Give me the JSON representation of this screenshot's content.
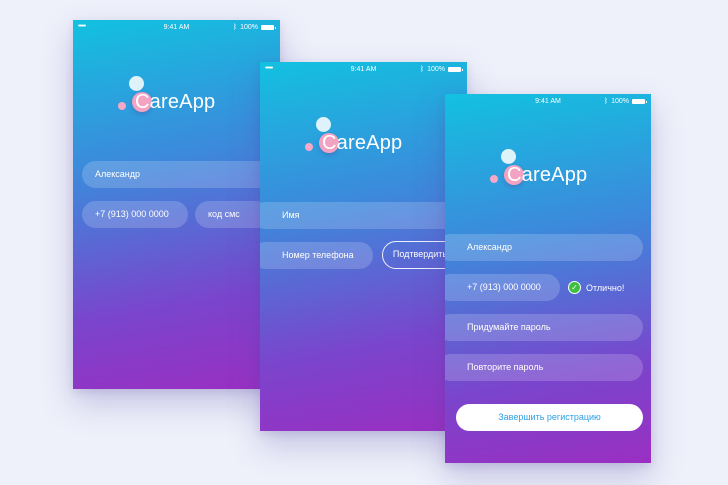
{
  "status_bar": {
    "time": "9:41 AM",
    "battery": "100%",
    "signal": "•••••",
    "wifi_icon": "wifi-icon",
    "bluetooth_icon": "bluetooth-icon"
  },
  "brand": {
    "c_letter": "C",
    "rest": "areApp"
  },
  "screen1": {
    "name_value": "Александр",
    "phone_value": "+7 (913) 000 0000",
    "sms_placeholder": "код смс"
  },
  "screen2": {
    "name_placeholder": "Имя",
    "phone_placeholder": "Номер телефона",
    "confirm_label": "Подтвердить"
  },
  "screen3": {
    "name_value": "Александр",
    "phone_value": "+7 (913) 000 0000",
    "ok_label": "Отлично!",
    "password_placeholder": "Придумайте пароль",
    "repeat_password_placeholder": "Повторите пароль",
    "finish_label": "Завершить регистрацию"
  },
  "colors": {
    "gradient_top": "#12c1e0",
    "gradient_bottom": "#9a2fc2",
    "accent_pink": "#f3a3c2",
    "success_green": "#3fbf3f",
    "cta_text": "#2c9fe6"
  }
}
